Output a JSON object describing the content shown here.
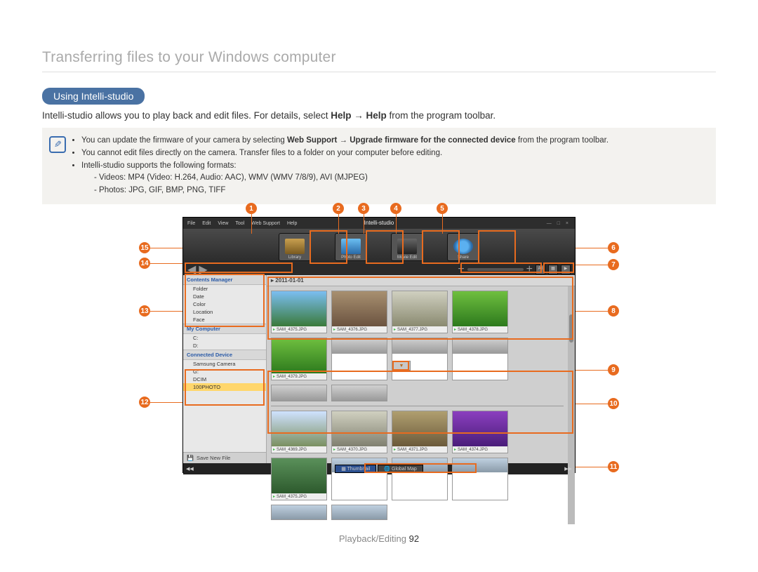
{
  "heading": "Transferring files to your Windows computer",
  "section_pill": "Using Intelli-studio",
  "intro_prefix": "Intelli-studio allows you to play back and edit files. For details, select ",
  "intro_help1": "Help",
  "intro_arrow": " → ",
  "intro_help2": "Help",
  "intro_suffix": " from the program toolbar.",
  "notes": {
    "n1_pre": "You can update the firmware of your camera by selecting ",
    "n1_b1": "Web Support",
    "n1_mid": " → ",
    "n1_b2": "Upgrade firmware for the connected device",
    "n1_post": " from the program toolbar.",
    "n2": "You cannot edit files directly on the camera. Transfer files to a folder on your computer before editing.",
    "n3": "Intelli-studio supports the following formats:",
    "n3a": "Videos: MP4 (Video: H.264, Audio: AAC), WMV (WMV 7/8/9), AVI (MJPEG)",
    "n3b": "Photos: JPG, GIF, BMP, PNG, TIFF"
  },
  "callouts": {
    "c1": "1",
    "c2": "2",
    "c3": "3",
    "c4": "4",
    "c5": "5",
    "c6": "6",
    "c7": "7",
    "c8": "8",
    "c9": "9",
    "c10": "10",
    "c11": "11",
    "c12": "12",
    "c13": "13",
    "c14": "14",
    "c15": "15"
  },
  "app": {
    "logo": "Intelli-studio",
    "menu": {
      "file": "File",
      "edit": "Edit",
      "view": "View",
      "tool": "Tool",
      "web": "Web Support",
      "help": "Help"
    },
    "tools": {
      "library": "Library",
      "photo": "Photo Edit",
      "movie": "Movie Edit",
      "share": "Share"
    },
    "slider_all": "All",
    "sidebar": {
      "cm": "Contents Manager",
      "folder": "Folder",
      "date": "Date",
      "color": "Color",
      "location": "Location",
      "face": "Face",
      "mc": "My Computer",
      "c": "C:",
      "d": "D:",
      "cd": "Connected Device",
      "cam": "Samsung Camera",
      "g": "G:",
      "dcim": "DCIM",
      "photo": "100PHOTO",
      "save": "Save New File"
    },
    "date_group": "2011-01-01",
    "thumbs_top": [
      {
        "cap": "SAM_4375.JPG",
        "bg": "linear-gradient(#7bbef2,#3a7a3a)"
      },
      {
        "cap": "SAM_4376.JPG",
        "bg": "linear-gradient(#a89070,#6b5340)"
      },
      {
        "cap": "SAM_4377.JPG",
        "bg": "linear-gradient(#d0d0c0,#8a8a70)"
      },
      {
        "cap": "SAM_4378.JPG",
        "bg": "linear-gradient(#6fbf3f,#2d7a1d)"
      },
      {
        "cap": "SAM_4379.JPG",
        "bg": "linear-gradient(#6fbf3f,#2d7a1d)"
      }
    ],
    "thumbs_bot": [
      {
        "cap": "SAM_4369.JPG",
        "bg": "linear-gradient(#cfe2ff,#7a9060)"
      },
      {
        "cap": "SAM_4370.JPG",
        "bg": "linear-gradient(#d0d0c0,#808070)"
      },
      {
        "cap": "SAM_4371.JPG",
        "bg": "linear-gradient(#b09f70,#6b5a3a)"
      },
      {
        "cap": "SAM_4374.JPG",
        "bg": "linear-gradient(#8b3fbf,#4a1d7a)"
      },
      {
        "cap": "SAM_4375.JPG",
        "bg": "linear-gradient(#5a905a,#2d5a2d)"
      }
    ],
    "status": {
      "thumb": "Thumbnail",
      "map": "Global Map"
    }
  },
  "footer": {
    "section": "Playback/Editing ",
    "page": "92"
  }
}
